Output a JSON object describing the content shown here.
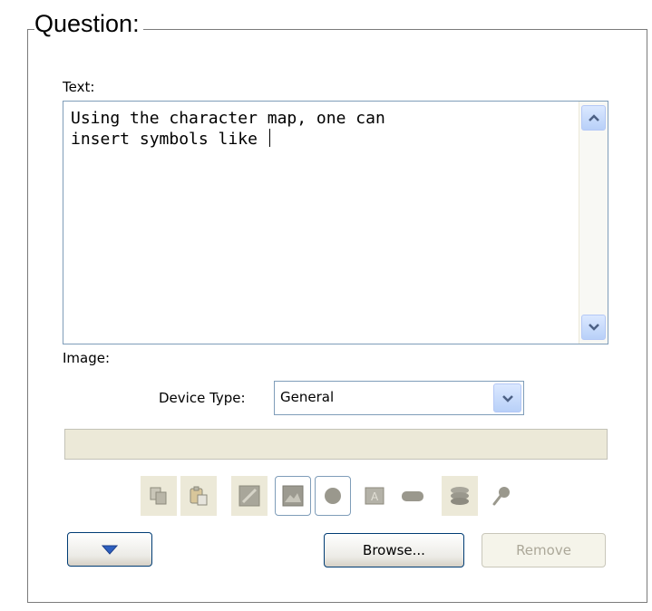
{
  "group": {
    "title": "Question:"
  },
  "text_field": {
    "label": "Text:",
    "value": "Using the character map, one can\ninsert symbols like "
  },
  "image_section": {
    "label": "Image:"
  },
  "device_type": {
    "label": "Device Type:",
    "selected": "General"
  },
  "toolbar": {
    "icons": [
      "copy-icon",
      "paste-icon",
      "edit-image-icon",
      "picture-icon",
      "circle-shape-icon",
      "text-frame-icon",
      "rounded-rect-icon",
      "layers-icon",
      "pin-icon"
    ]
  },
  "buttons": {
    "browse": "Browse...",
    "remove": "Remove"
  },
  "colors": {
    "accent_blue": "#b8d0f8",
    "border_blue": "#7f9db9",
    "panel_beige": "#ece9d8",
    "disabled_text": "#aca899"
  }
}
